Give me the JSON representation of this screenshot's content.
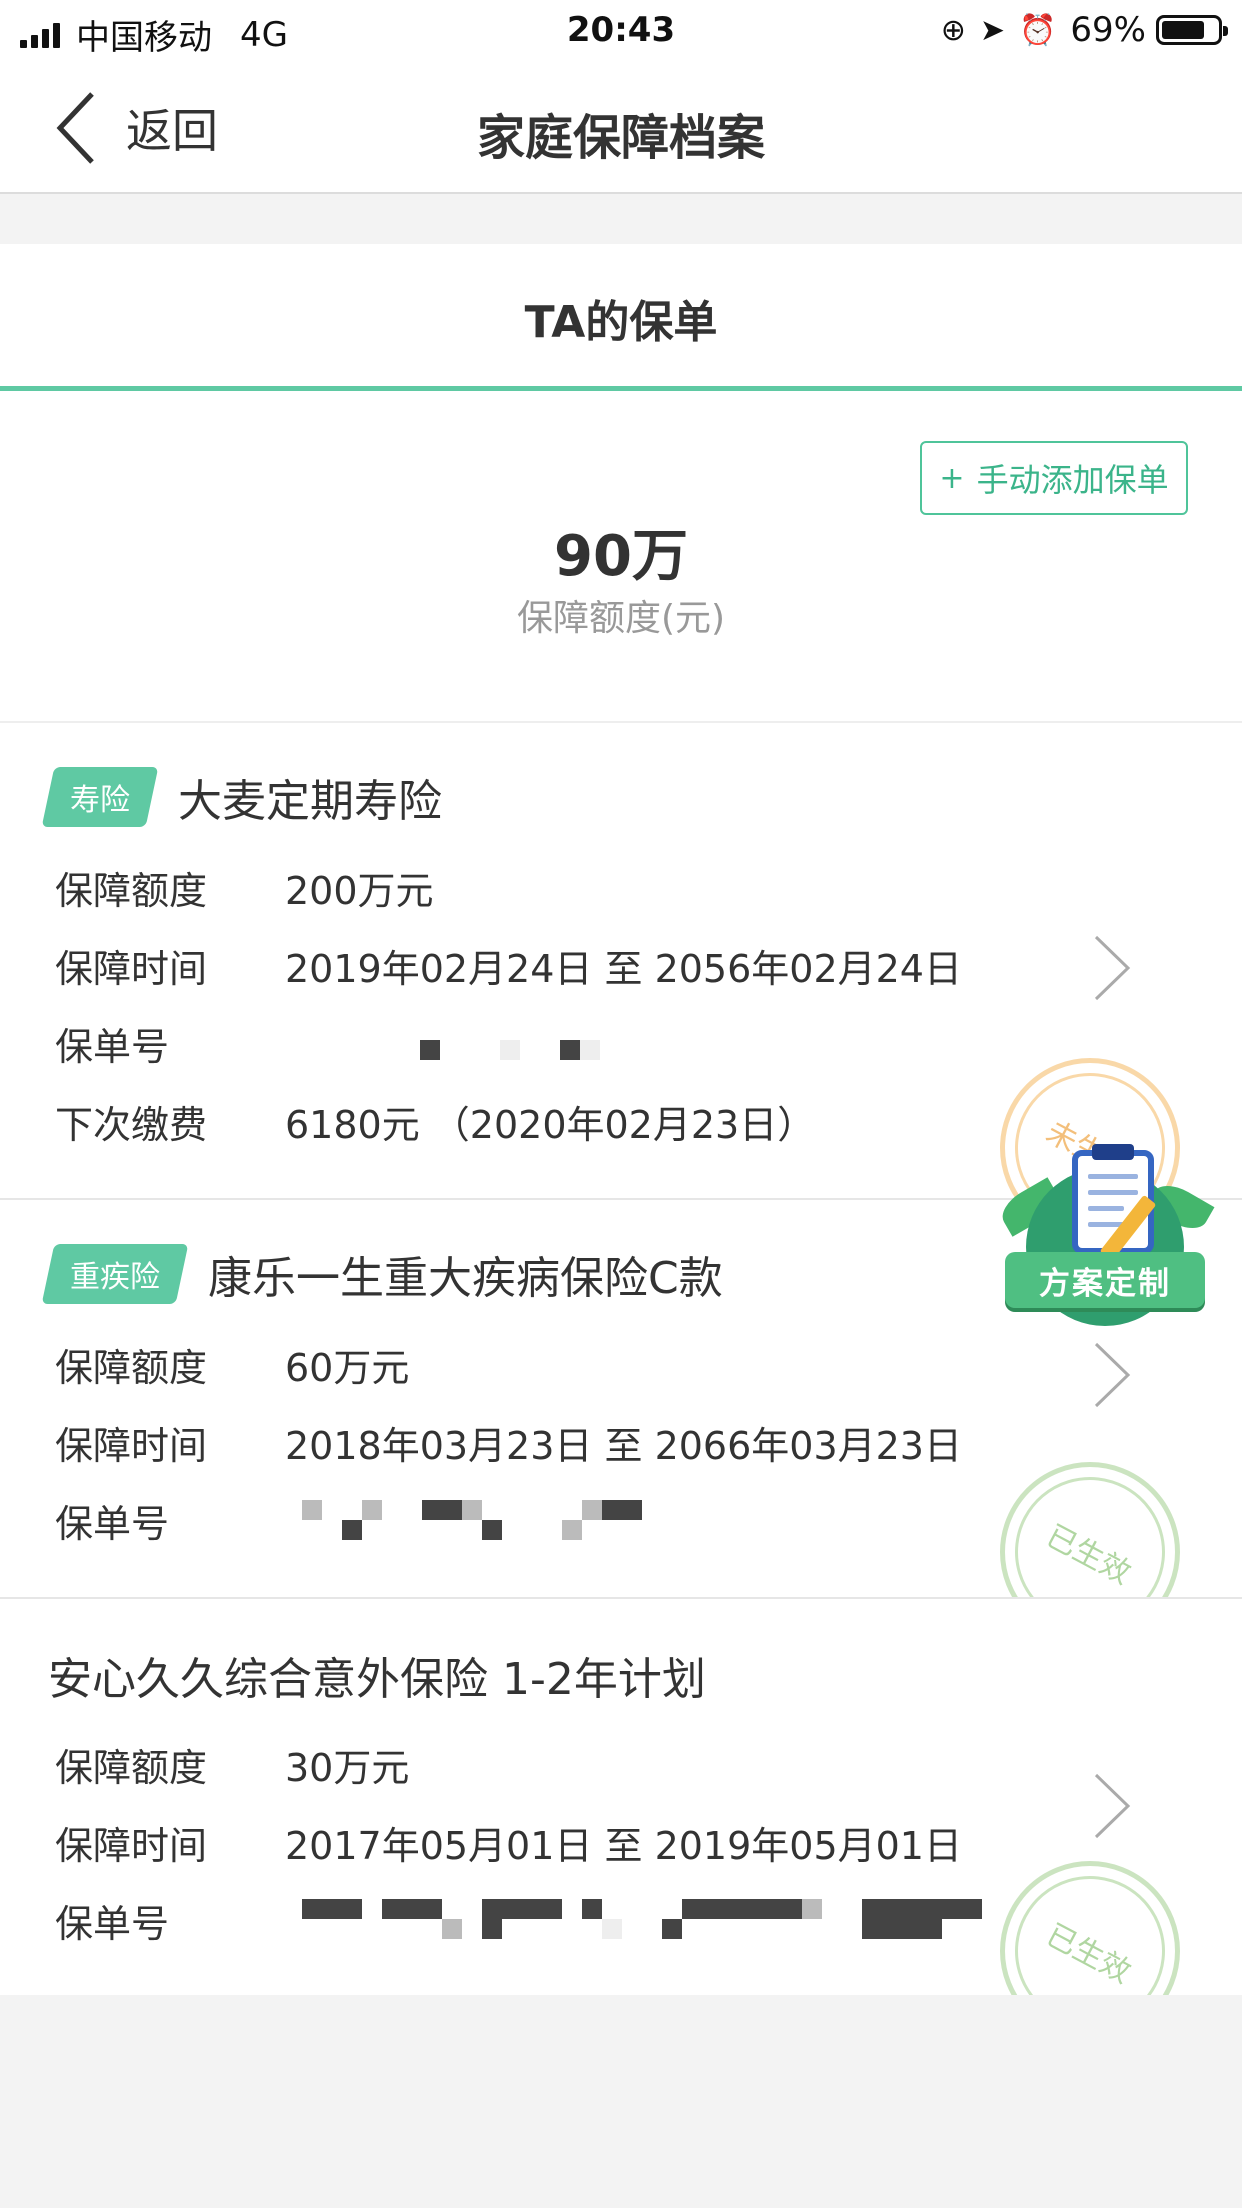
{
  "status_bar": {
    "carrier": "中国移动",
    "network": "4G",
    "time": "20:43",
    "battery": "69%"
  },
  "nav": {
    "back_label": "返回",
    "title": "家庭保障档案"
  },
  "tab": {
    "label": "TA的保单"
  },
  "summary": {
    "add_button": "手动添加保单",
    "amount": "90万",
    "amount_label": "保障额度(元)"
  },
  "labels": {
    "coverage": "保障额度",
    "period": "保障时间",
    "policy_no": "保单号",
    "next_payment": "下次缴费"
  },
  "policies": [
    {
      "tag": "寿险",
      "name": "大麦定期寿险",
      "coverage": "200万元",
      "period": "2019年02月24日  至  2056年02月24日",
      "next_payment": "6180元  （2020年02月23日）",
      "stamp": "未生效"
    },
    {
      "tag": "重疾险",
      "name": "康乐一生重大疾病保险C款",
      "coverage": "60万元",
      "period": "2018年03月23日  至  2066年03月23日",
      "stamp": "已生效"
    },
    {
      "name": "安心久久综合意外保险 1-2年计划",
      "coverage": "30万元",
      "period": "2017年05月01日  至  2019年05月01日",
      "stamp": "已生效"
    }
  ],
  "float_badge": {
    "label": "方案定制"
  },
  "colors": {
    "accent": "#5fc9a3",
    "stamp_active": "#a0cd8c",
    "stamp_inactive": "#f5be6e"
  }
}
